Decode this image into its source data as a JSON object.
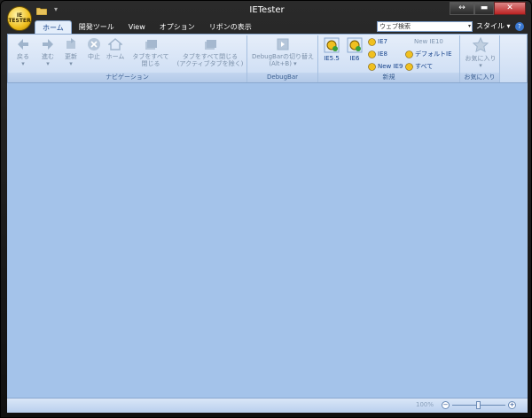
{
  "window": {
    "title": "IETester"
  },
  "orb": {
    "label": "IE TESTER"
  },
  "tabs": [
    "ホーム",
    "開発ツール",
    "View",
    "オプション",
    "リボンの表示"
  ],
  "search": {
    "placeholder": "ウェブ検索"
  },
  "style_label": "スタイル",
  "groups": {
    "navigation": {
      "label": "ナビゲーション",
      "buttons": {
        "back": "戻る",
        "forward": "進む",
        "refresh": "更新",
        "stop": "中止",
        "home": "ホーム",
        "close_all_1": "タブをすべて",
        "close_all_2": "閉じる",
        "close_others_1": "タブをすべて閉じる",
        "close_others_2": "(アクティブタブを除く)"
      }
    },
    "debugbar": {
      "label": "DebugBar",
      "toggle_1": "DebugBarの切り替え",
      "toggle_2": "(Alt+B)"
    },
    "new": {
      "label": "新規",
      "ie55": "IE5.5",
      "ie6": "IE6",
      "ie7": "IE7",
      "ie8": "IE8",
      "newie9": "New IE9",
      "newie10": "New IE10",
      "default_ie": "デフォルトIE",
      "all": "すべて"
    },
    "favorites": {
      "label": "お気に入り",
      "button": "お気に入り"
    }
  },
  "status": {
    "zoom": "100%"
  }
}
